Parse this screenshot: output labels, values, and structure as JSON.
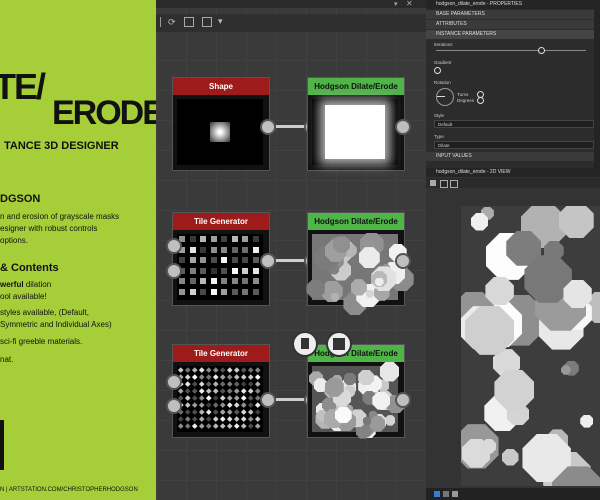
{
  "promo": {
    "title_line1": "TE/",
    "title_line2": "ERODE",
    "subtitle": "TANCE 3D DESIGNER",
    "author": "DGSON",
    "desc1": "n and erosion of grayscale masks",
    "desc2": "esigner with robust controls",
    "desc3": "options.",
    "contents_heading": "& Contents",
    "c1a": "werful",
    "c1b": " dilation",
    "c2": "ool available!",
    "c3": "styles available, (Default,",
    "c4": "Symmetric and Individual Axes)",
    "c5": "sci-fi greeble materials.",
    "c6": "nat.",
    "footer": "N | ARTSTATION.COM/CHRISTOPHERHODGSON"
  },
  "graph": {
    "nodes": [
      {
        "title": "Shape"
      },
      {
        "title": "Hodgson Dilate/Erode"
      },
      {
        "title": "Tile Generator"
      },
      {
        "title": "Hodgson Dilate/Erode"
      },
      {
        "title": "Tile Generator"
      },
      {
        "title": "Hodgson Dilate/Erode"
      }
    ]
  },
  "props": {
    "title": "hodgson_dilate_erode - PROPERTIES",
    "sections": {
      "base": "BASE PARAMETERS",
      "attributes": "ATTRIBUTES",
      "instance": "INSTANCE PARAMETERS",
      "input_values": "INPUT VALUES"
    },
    "iterations_label": "Iterations",
    "iterations_value": 0.7,
    "gradient_label": "Gradient",
    "rotation_label": "Rotation",
    "turns_label": "Turns",
    "degrees_label": "Degrees",
    "style_label": "Style",
    "style_value": "Default",
    "type_label": "Type",
    "type_value": "Dilate"
  },
  "view2d": {
    "title": "hodgson_dilate_erode - 2D VIEW"
  },
  "colors": {
    "promo_bg": "#a6ce39",
    "node_red": "#9e1b1b",
    "node_green": "#4fb548"
  }
}
